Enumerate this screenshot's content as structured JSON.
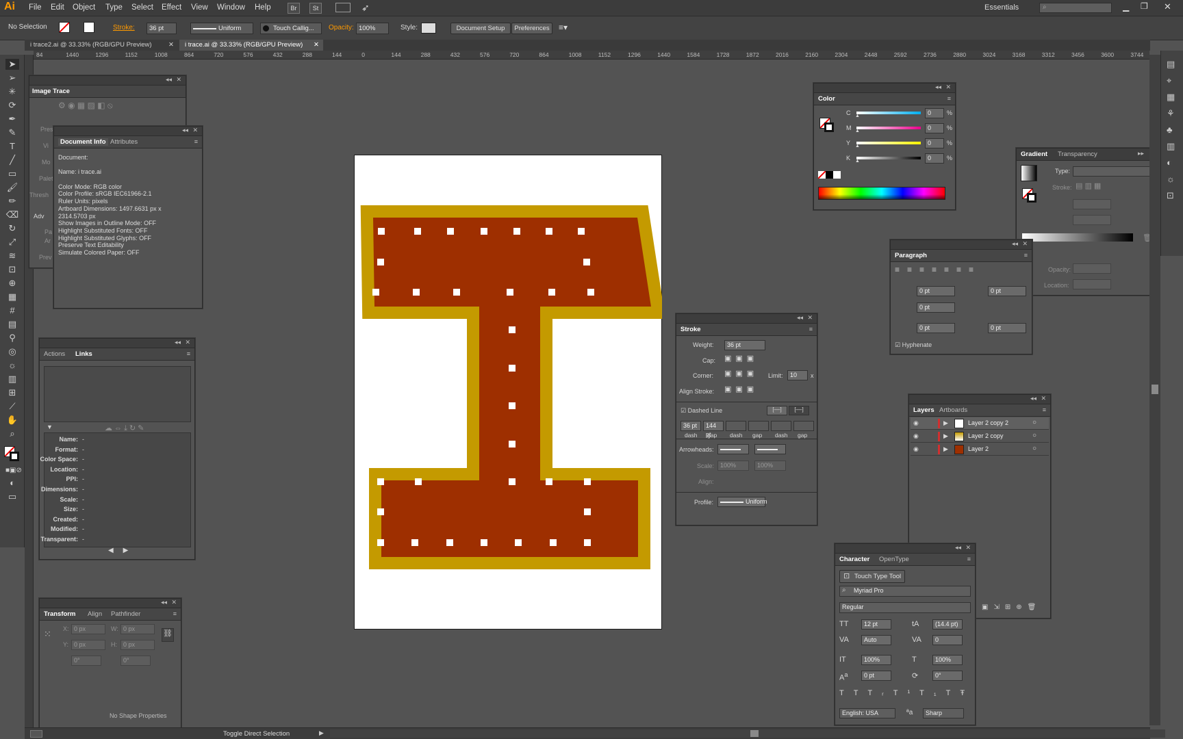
{
  "app": {
    "logo": "Ai"
  },
  "menu": [
    "File",
    "Edit",
    "Object",
    "Type",
    "Select",
    "Effect",
    "View",
    "Window",
    "Help"
  ],
  "menu_extra": {
    "br": "Br",
    "st": "St",
    "workspace": "Essentials"
  },
  "control": {
    "selection": "No Selection",
    "stroke_label": "Stroke:",
    "stroke_value": "36 pt",
    "uniform": "Uniform",
    "brush": "Touch Callig...",
    "opacity_label": "Opacity:",
    "opacity_value": "100%",
    "style_label": "Style:",
    "doc_setup": "Document Setup",
    "preferences": "Preferences"
  },
  "tabs": [
    {
      "label": "i trace2.ai @ 33.33% (RGB/GPU Preview)"
    },
    {
      "label": "i trace.ai @ 33.33% (RGB/GPU Preview)"
    }
  ],
  "ruler_ticks": [
    "84",
    "1440",
    "1296",
    "1152",
    "1008",
    "864",
    "720",
    "576",
    "432",
    "288",
    "144",
    "0",
    "144",
    "288",
    "432",
    "576",
    "720",
    "864",
    "1008",
    "1152",
    "1296",
    "1440",
    "1584",
    "1728",
    "1872",
    "2016",
    "2160",
    "2304",
    "2448",
    "2592",
    "2736",
    "2880",
    "3024",
    "3168",
    "3312",
    "3456",
    "3600",
    "3744"
  ],
  "image_trace": {
    "title": "Image Trace",
    "labels": [
      "Pres",
      "Vi",
      "Mo",
      "Palet",
      "Thresh",
      "Adv",
      "Pa",
      "Ar",
      "Prev"
    ]
  },
  "doc_info": {
    "tabs": [
      "Document Info",
      "Attributes"
    ],
    "lines": [
      "Document:",
      "",
      "Name: i trace.ai",
      "",
      "Color Mode: RGB color",
      "Color Profile: sRGB IEC61966-2.1",
      "Ruler Units: pixels",
      "Artboard Dimensions: 1497.6631 px x",
      "2314.5703 px",
      "Show Images in Outline Mode: OFF",
      "Highlight Substituted Fonts: OFF",
      "Highlight Substituted Glyphs: OFF",
      "Preserve Text Editability",
      "Simulate Colored Paper: OFF"
    ]
  },
  "links": {
    "tabs": [
      "Actions",
      "Links"
    ],
    "fields": [
      [
        "Name:",
        "-"
      ],
      [
        "Format:",
        "-"
      ],
      [
        "Color Space:",
        "-"
      ],
      [
        "Location:",
        "-"
      ],
      [
        "PPI:",
        "-"
      ],
      [
        "Dimensions:",
        "-"
      ],
      [
        "Scale:",
        "-"
      ],
      [
        "Size:",
        "-"
      ],
      [
        "Created:",
        "-"
      ],
      [
        "Modified:",
        "-"
      ],
      [
        "Transparent:",
        "-"
      ]
    ]
  },
  "transform": {
    "tabs": [
      "Transform",
      "Align",
      "Pathfinder"
    ],
    "x": "0 px",
    "y": "0 px",
    "w": "0 px",
    "h": "0 px",
    "rot": "0°",
    "shear": "0°",
    "xl": "X:",
    "yl": "Y:",
    "wl": "W:",
    "hl": "H:",
    "empty": "No Shape Properties"
  },
  "color": {
    "title": "Color",
    "channels": [
      [
        "C",
        "0"
      ],
      [
        "M",
        "0"
      ],
      [
        "Y",
        "0"
      ],
      [
        "K",
        "0"
      ]
    ],
    "pct": "%"
  },
  "gradient": {
    "tabs": [
      "Gradient",
      "Transparency"
    ],
    "type_label": "Type:",
    "stroke_label": "Stroke:",
    "opacity_label": "Opacity:",
    "location_label": "Location:"
  },
  "paragraph": {
    "title": "Paragraph",
    "v1": "0 pt",
    "v2": "0 pt",
    "v3": "0 pt",
    "v4": "0 pt",
    "v5": "0 pt",
    "hyphenate": "Hyphenate"
  },
  "stroke": {
    "title": "Stroke",
    "weight_label": "Weight:",
    "weight": "36 pt",
    "cap_label": "Cap:",
    "corner_label": "Corner:",
    "limit_label": "Limit:",
    "limit": "10",
    "x": "x",
    "align_label": "Align Stroke:",
    "dashed": "Dashed Line",
    "dash_vals": [
      "36 pt",
      "144 pt",
      "",
      "",
      "",
      ""
    ],
    "dash_labels": [
      "dash",
      "gap",
      "dash",
      "gap",
      "dash",
      "gap"
    ],
    "arrow_label": "Arrowheads:",
    "scale_label": "Scale:",
    "scale1": "100%",
    "scale2": "100%",
    "align2_label": "Align:",
    "profile_label": "Profile:",
    "profile": "Uniform"
  },
  "layers": {
    "tabs": [
      "Layers",
      "Artboards"
    ],
    "items": [
      "Layer 2 copy 2",
      "Layer 2 copy",
      "Layer 2"
    ]
  },
  "character": {
    "tabs": [
      "Character",
      "OpenType"
    ],
    "touch": "Touch Type Tool",
    "font": "Myriad Pro",
    "style": "Regular",
    "size": "12 pt",
    "leading": "(14.4 pt)",
    "kern": "Auto",
    "track": "0",
    "vscale": "100%",
    "hscale": "100%",
    "baseline": "0 pt",
    "rotate": "0°",
    "lang": "English: USA",
    "aa": "Sharp"
  },
  "status": {
    "text": "Toggle Direct Selection"
  },
  "colors": {
    "fill": "#9e2f00",
    "stroke": "#c49a00",
    "accent": "#ff9a00"
  }
}
